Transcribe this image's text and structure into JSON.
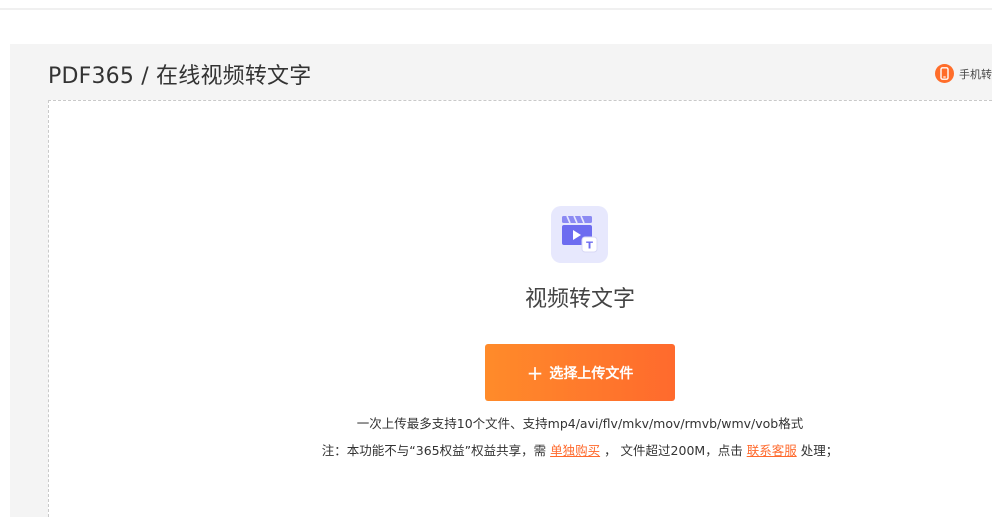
{
  "page": {
    "title": "PDF365 / 在线视频转文字",
    "mobile_link": "手机转"
  },
  "tool": {
    "icon": "video-to-text-icon",
    "name": "视频转文字"
  },
  "upload": {
    "button_label": "选择上传文件",
    "button_icon": "plus-icon"
  },
  "hints": {
    "line1": "一次上传最多支持10个文件、支持mp4/avi/flv/mkv/mov/rmvb/wmv/vob格式",
    "line2_prefix": "注：本功能不与“365权益”权益共享，需",
    "purchase_link": "单独购买",
    "line2_middle": "，  文件超过200M，点击",
    "service_link": "联系客服",
    "line2_suffix": "处理；"
  },
  "colors": {
    "accent": "#ff6a2d",
    "accent_start": "#ff8b2a",
    "icon_bg": "#e7e8fd",
    "icon_fg": "#6d6cf0",
    "panel_bg": "#f4f4f4"
  }
}
